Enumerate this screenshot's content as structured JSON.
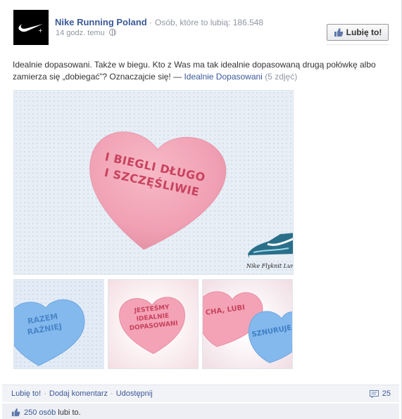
{
  "header": {
    "page_name": "Nike Running Poland",
    "likes_count": "Osób, które to lubią: 186.548",
    "timestamp": "14 godz. temu",
    "like_button_label": "Lubię to!"
  },
  "message": {
    "text": "Idealnie dopasowani. Także w biegu. Kto z Was ma tak idealnie dopasowaną drugą połówkę albo zamierza się „dobiegać”? Oznaczajcie się!",
    "dash": " — ",
    "album_link": "Idealnie Dopasowani",
    "photo_count": "(5 zdjęć)"
  },
  "photos": {
    "main": {
      "heart_line1": "I BIEGLI DŁUGO",
      "heart_line2": "I SZCZĘŚLIWIE",
      "caption": "Nike Flyknit Lunar"
    },
    "thumb1": {
      "line1": "RAZEM",
      "line2": "RAŹNIEJ"
    },
    "thumb2": {
      "line1": "JESTEŚMY",
      "line2": "IDEALNIE",
      "line3": "DOPASOWANI"
    },
    "thumb3": {
      "left_text": "CHA, LUBI",
      "right_text": "SZNURUJE"
    }
  },
  "actions": {
    "like": "Lubię to!",
    "comment": "Dodaj komentarz",
    "share": "Udostępnij",
    "comments_count": "25"
  },
  "likes": {
    "count_link": "250 osób",
    "suffix": "lubi to."
  },
  "colors": {
    "link": "#3b5998",
    "muted": "#9197a3",
    "heart_pink": "#f4a3b6",
    "heart_blue": "#7fb6ec"
  }
}
